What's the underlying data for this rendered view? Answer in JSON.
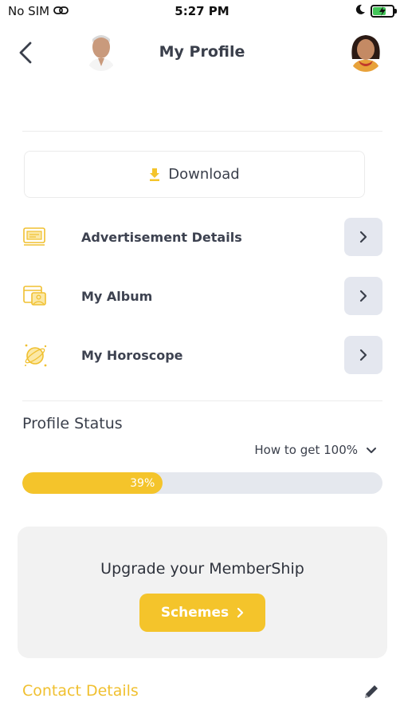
{
  "status_bar": {
    "carrier": "No SIM",
    "time": "5:27 PM"
  },
  "header": {
    "title": "My Profile"
  },
  "download": {
    "label": "Download"
  },
  "menu": {
    "items": [
      {
        "label": "Advertisement Details",
        "icon": "advertisement-icon"
      },
      {
        "label": "My Album",
        "icon": "album-icon"
      },
      {
        "label": "My Horoscope",
        "icon": "horoscope-icon"
      }
    ]
  },
  "profile_status": {
    "title": "Profile Status",
    "howto_label": "How to get 100%",
    "progress_percent": 39,
    "progress_label": "39%"
  },
  "upgrade": {
    "title": "Upgrade your MemberShip",
    "button_label": "Schemes"
  },
  "contact": {
    "title": "Contact Details"
  },
  "colors": {
    "accent": "#f4c42b",
    "text": "#3a3f4b",
    "chevron_bg": "#e4e7ef",
    "card_bg": "#f2f2f2"
  }
}
